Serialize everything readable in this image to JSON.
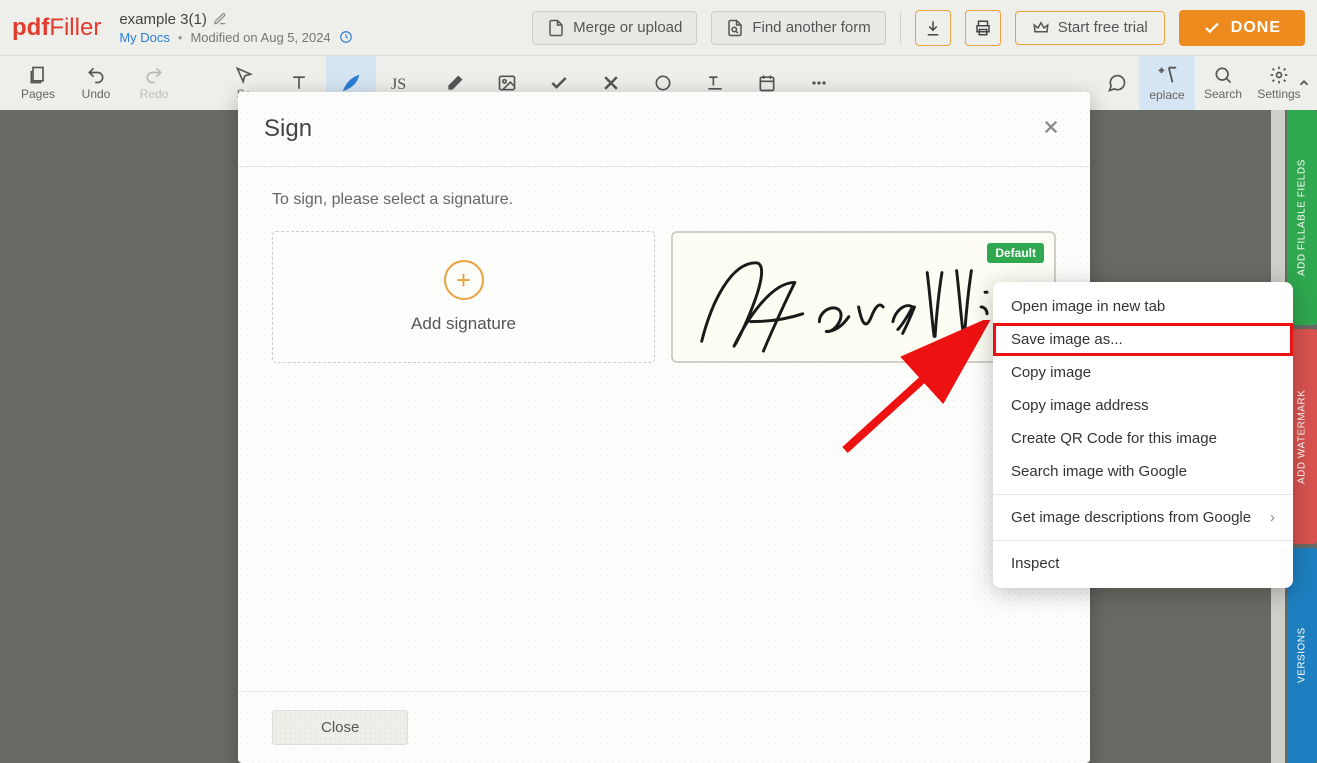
{
  "logo": {
    "bold": "pdf",
    "thin": "Filler"
  },
  "doc": {
    "title": "example 3(1)",
    "mydocs": "My Docs",
    "modified": "Modified on Aug 5, 2024"
  },
  "header_buttons": {
    "merge": "Merge or upload",
    "find": "Find another form",
    "trial": "Start free trial",
    "done": "DONE"
  },
  "toolbar": {
    "pages": "Pages",
    "undo": "Undo",
    "redo": "Redo",
    "select": "Se",
    "replace": "eplace",
    "search": "Search",
    "settings": "Settings"
  },
  "modal": {
    "title": "Sign",
    "prompt": "To sign, please select a signature.",
    "add_label": "Add signature",
    "default_badge": "Default",
    "signature_text": "Ravellin",
    "close": "Close"
  },
  "context_menu": {
    "items": [
      "Open image in new tab",
      "Save image as...",
      "Copy image",
      "Copy image address",
      "Create QR Code for this image",
      "Search image with Google"
    ],
    "group2": [
      "Get image descriptions from Google"
    ],
    "group3": [
      "Inspect"
    ]
  },
  "rail": {
    "green": "ADD FILLABLE FIELDS",
    "red": "ADD WATERMARK",
    "blue": "VERSIONS"
  }
}
